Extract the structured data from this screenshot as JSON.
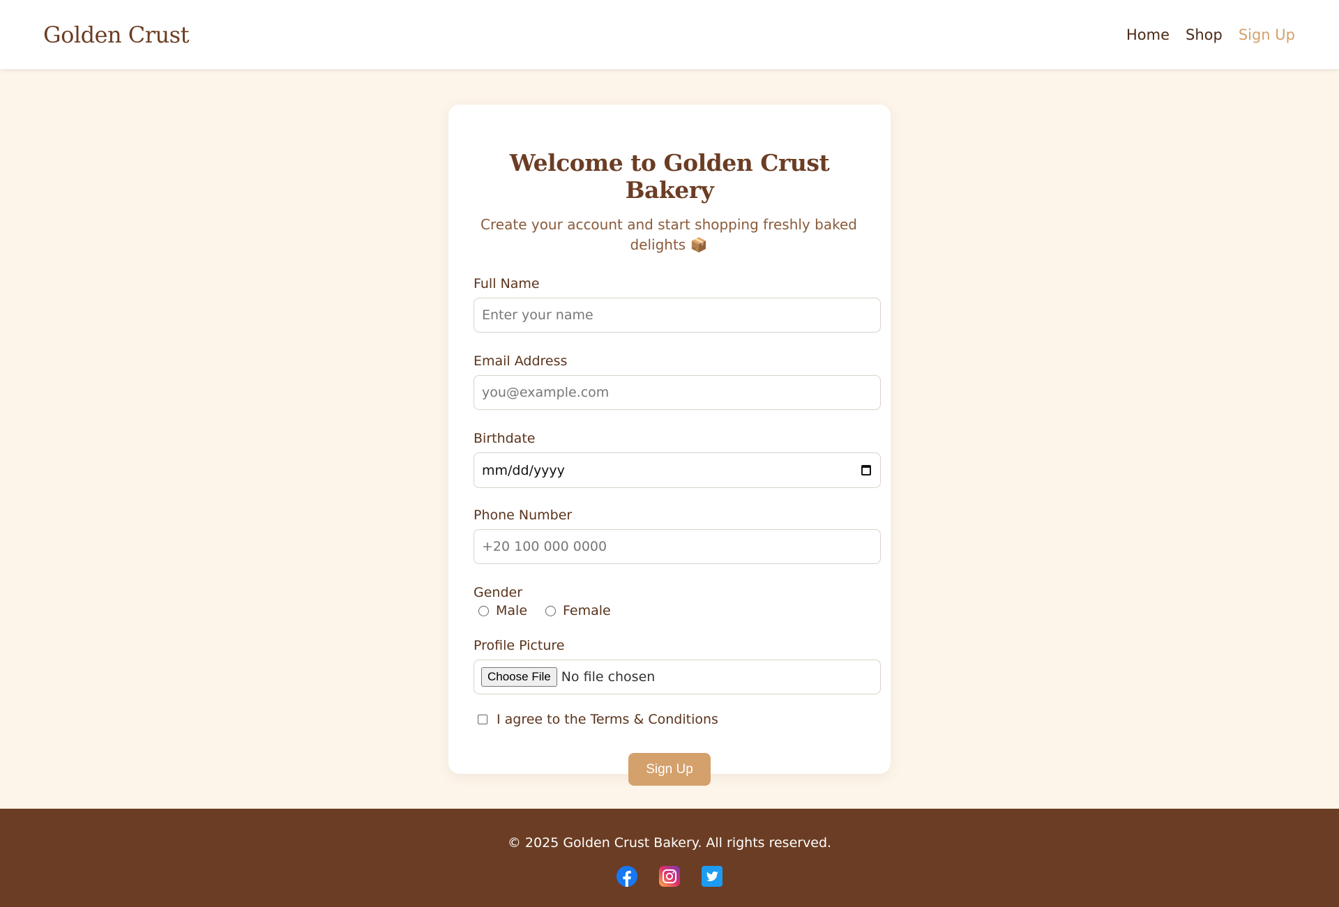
{
  "header": {
    "brand": "Golden Crust",
    "nav": [
      {
        "label": "Home"
      },
      {
        "label": "Shop"
      },
      {
        "label": "Sign Up"
      }
    ]
  },
  "form": {
    "title": "Welcome to Golden Crust Bakery",
    "subtitle": "Create your account and start shopping freshly baked delights 📦",
    "full_name": {
      "label": "Full Name",
      "placeholder": "Enter your name"
    },
    "email": {
      "label": "Email Address",
      "placeholder": "you@example.com"
    },
    "birthdate": {
      "label": "Birthdate",
      "placeholder": "mm/dd/yyyy"
    },
    "phone": {
      "label": "Phone Number",
      "placeholder": "+20 100 000 0000"
    },
    "gender": {
      "label": "Gender",
      "options": [
        "Male",
        "Female"
      ]
    },
    "profile_picture": {
      "label": "Profile Picture",
      "button": "Choose File",
      "status": "No file chosen"
    },
    "terms": {
      "label": "I agree to the Terms & Conditions"
    },
    "submit": "Sign Up"
  },
  "footer": {
    "copyright": "© 2025 Golden Crust Bakery. All rights reserved.",
    "socials": [
      "facebook-icon",
      "instagram-icon",
      "twitter-icon"
    ]
  },
  "colors": {
    "accent": "#d4a06c",
    "brown": "#6b3d24",
    "background": "#fdf5ea"
  }
}
